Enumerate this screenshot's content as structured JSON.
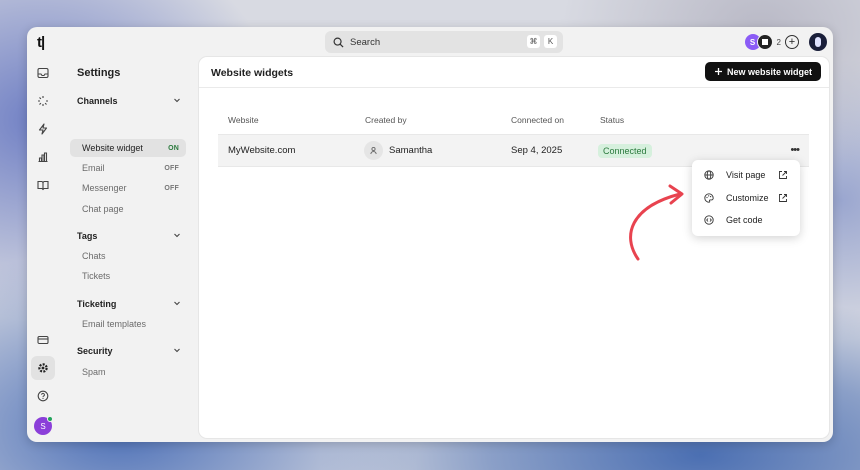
{
  "app": {
    "logo": "t|"
  },
  "search": {
    "label": "Search",
    "shortcut_mod": "⌘",
    "shortcut_key": "K"
  },
  "topbar": {
    "avatar_initial": "S",
    "member_count": "2"
  },
  "rail": {
    "user_initial": "S"
  },
  "settings": {
    "title": "Settings",
    "groups": [
      {
        "label": "Channels",
        "items": [
          {
            "label": "Website widget",
            "status": "ON"
          },
          {
            "label": "Email",
            "status": "OFF"
          },
          {
            "label": "Messenger",
            "status": "OFF"
          },
          {
            "label": "Chat page",
            "status": ""
          }
        ]
      },
      {
        "label": "Tags",
        "items": [
          {
            "label": "Chats"
          },
          {
            "label": "Tickets"
          }
        ]
      },
      {
        "label": "Ticketing",
        "items": [
          {
            "label": "Email templates"
          }
        ]
      },
      {
        "label": "Security",
        "items": [
          {
            "label": "Spam"
          }
        ]
      }
    ]
  },
  "main": {
    "title": "Website widgets",
    "new_button": "New website widget",
    "columns": [
      "Website",
      "Created by",
      "Connected on",
      "Status"
    ],
    "rows": [
      {
        "website": "MyWebsite.com",
        "created_by": "Samantha",
        "connected_on": "Sep 4, 2025",
        "status": "Connected"
      }
    ]
  },
  "menu": {
    "items": [
      {
        "label": "Visit page",
        "icon": "globe-icon",
        "external": true
      },
      {
        "label": "Customize",
        "icon": "palette-icon",
        "external": true
      },
      {
        "label": "Get code",
        "icon": "code-icon",
        "external": false
      }
    ]
  },
  "colors": {
    "accent": "#8b3fd9",
    "connected_bg": "#d6f0dd",
    "connected_fg": "#2b7a3d",
    "arrow": "#e8434f"
  }
}
